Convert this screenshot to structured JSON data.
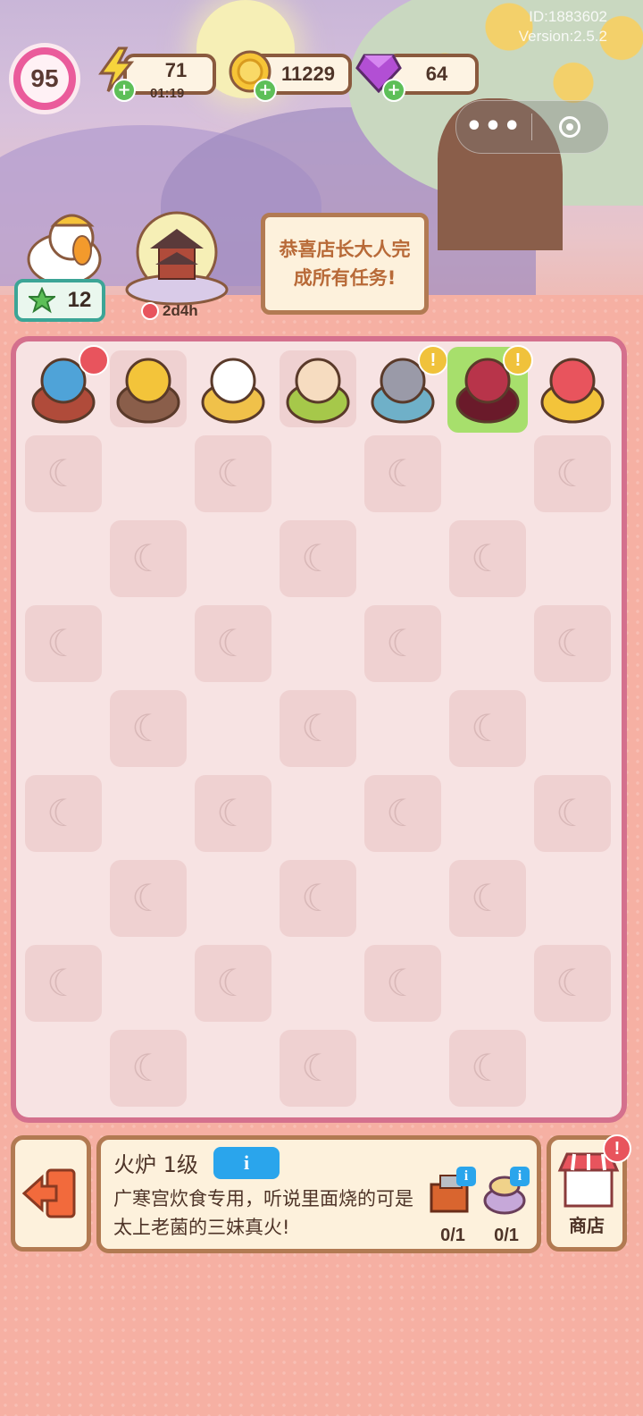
{
  "hud": {
    "level": "95",
    "energy": {
      "value": "71",
      "timer": "01:19"
    },
    "coins": {
      "value": "11229"
    },
    "gems": {
      "value": "64"
    }
  },
  "meta": {
    "id": "ID:1883602",
    "version": "Version:2.5.2"
  },
  "capsule": {
    "more_icon": "more-dots-icon",
    "close_icon": "target-icon"
  },
  "side": {
    "stars": "12",
    "event_timer": "2d4h"
  },
  "banner": {
    "text": "恭喜店长大人完成所有任务!"
  },
  "board": {
    "rows": 9,
    "cols": 7,
    "items": [
      {
        "name": "pavilion-item",
        "badge": "clock"
      },
      {
        "name": "osmanthus-tree-item",
        "badge": ""
      },
      {
        "name": "bunny-stir-basket-item",
        "badge": ""
      },
      {
        "name": "bunny-stir-bowl-item",
        "badge": ""
      },
      {
        "name": "bunny-mortar-item",
        "badge": "!"
      },
      {
        "name": "furnace-item",
        "badge": "!"
      },
      {
        "name": "gift-box-item",
        "badge": ""
      }
    ]
  },
  "info": {
    "title": "火炉 1级",
    "info_button": "i",
    "description": "广寒宫炊食专用，听说里面烧的可是太上老菌的三妹真火!",
    "requirements": [
      {
        "name": "bricks",
        "count": "0/1"
      },
      {
        "name": "sacks",
        "count": "0/1"
      }
    ]
  },
  "shop": {
    "label": "商店",
    "badge": "!"
  },
  "colors": {
    "background": "#f7b4a8",
    "board_border": "#d4708d",
    "panel": "#fdf1dc",
    "panel_border": "#b27a52",
    "info_blue": "#2aa5ec",
    "level_pink": "#ea5b9b"
  }
}
